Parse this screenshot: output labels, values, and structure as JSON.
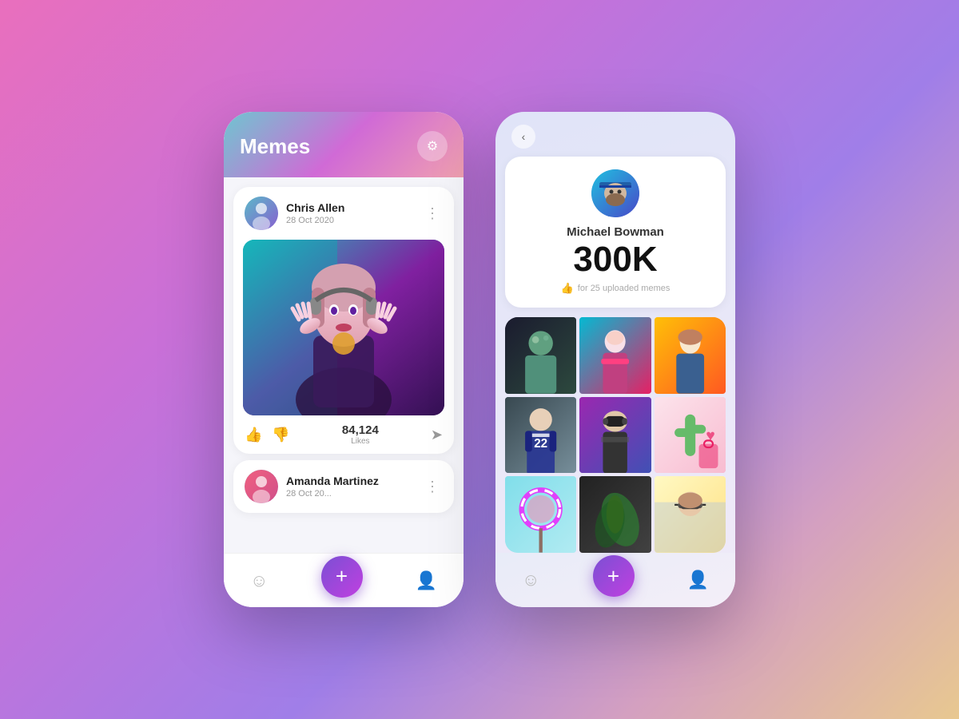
{
  "background": {
    "gradient": "linear-gradient(135deg, #e96fbd 0%, #c970d8 30%, #a07ee8 60%, #d4a0c0 80%, #e8c890 100%)"
  },
  "left_phone": {
    "title": "Memes",
    "settings_icon": "⚙",
    "post1": {
      "user_name": "Chris Allen",
      "date": "28 Oct 2020",
      "more_icon": "⋮",
      "likes": "84,124",
      "likes_label": "Likes"
    },
    "post2": {
      "user_name": "Amanda Martinez",
      "date": "28 Oct 20..."
    },
    "nav": {
      "home_icon": "☺",
      "add_icon": "+",
      "profile_icon": "👤"
    }
  },
  "right_phone": {
    "back_icon": "‹",
    "profile": {
      "name": "Michael Bowman",
      "count": "300K",
      "desc": "for 25 uploaded memes",
      "thumb_icon": "👍"
    },
    "grid_items": [
      {
        "id": 1,
        "color_class": "gi-1",
        "label": "dark portrait"
      },
      {
        "id": 2,
        "color_class": "gi-2",
        "label": "colorful dance"
      },
      {
        "id": 3,
        "color_class": "gi-3",
        "label": "yellow outfit"
      },
      {
        "id": 4,
        "color_class": "gi-4",
        "label": "football player"
      },
      {
        "id": 5,
        "color_class": "gi-5",
        "label": "vr headset"
      },
      {
        "id": 6,
        "color_class": "gi-6",
        "label": "pink aesthetic"
      },
      {
        "id": 7,
        "color_class": "gi-7",
        "label": "lollipop"
      },
      {
        "id": 8,
        "color_class": "gi-8",
        "label": "dark abstract"
      },
      {
        "id": 9,
        "color_class": "gi-9",
        "label": "sunglasses"
      }
    ],
    "nav": {
      "emoji_icon": "☺",
      "add_icon": "+",
      "profile_icon": "👤"
    }
  }
}
